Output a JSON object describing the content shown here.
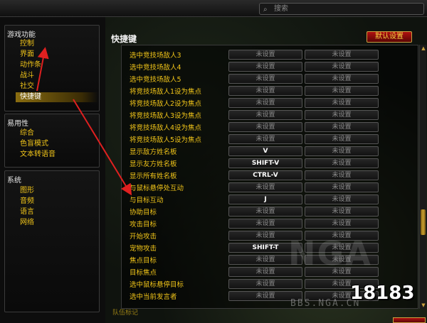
{
  "search": {
    "placeholder": "搜索"
  },
  "sidebar": {
    "sections": [
      {
        "title": "游戏功能",
        "items": [
          "控制",
          "界面",
          "动作条",
          "战斗",
          "社交",
          "快捷键"
        ],
        "selected": 5
      },
      {
        "title": "易用性",
        "items": [
          "综合",
          "色盲模式",
          "文本转语音"
        ]
      },
      {
        "title": "系统",
        "items": [
          "图形",
          "音频",
          "语言",
          "网络"
        ]
      }
    ]
  },
  "main": {
    "title": "快捷键",
    "default_button": "默认设置",
    "bindings": [
      {
        "label": "选中竞技场敌人3",
        "key1": "未设置",
        "key2": "未设置"
      },
      {
        "label": "选中竞技场敌人4",
        "key1": "未设置",
        "key2": "未设置"
      },
      {
        "label": "选中竞技场敌人5",
        "key1": "未设置",
        "key2": "未设置"
      },
      {
        "label": "将竞技场敌人1设为焦点",
        "key1": "未设置",
        "key2": "未设置"
      },
      {
        "label": "将竞技场敌人2设为焦点",
        "key1": "未设置",
        "key2": "未设置"
      },
      {
        "label": "将竞技场敌人3设为焦点",
        "key1": "未设置",
        "key2": "未设置"
      },
      {
        "label": "将竞技场敌人4设为焦点",
        "key1": "未设置",
        "key2": "未设置"
      },
      {
        "label": "将竞技场敌人5设为焦点",
        "key1": "未设置",
        "key2": "未设置"
      },
      {
        "label": "显示敌方姓名板",
        "key1": "V",
        "key2": "未设置"
      },
      {
        "label": "显示友方姓名板",
        "key1": "SHIFT-V",
        "key2": "未设置"
      },
      {
        "label": "显示所有姓名板",
        "key1": "CTRL-V",
        "key2": "未设置"
      },
      {
        "label": "与鼠标悬停处互动",
        "key1": "未设置",
        "key2": "未设置"
      },
      {
        "label": "与目标互动",
        "key1": "J",
        "key2": "未设置"
      },
      {
        "label": "协助目标",
        "key1": "未设置",
        "key2": "未设置"
      },
      {
        "label": "攻击目标",
        "key1": "未设置",
        "key2": "未设置"
      },
      {
        "label": "开始攻击",
        "key1": "未设置",
        "key2": "未设置"
      },
      {
        "label": "宠物攻击",
        "key1": "SHIFT-T",
        "key2": "未设置"
      },
      {
        "label": "焦点目标",
        "key1": "未设置",
        "key2": "未设置"
      },
      {
        "label": "目标焦点",
        "key1": "未设置",
        "key2": "未设置"
      },
      {
        "label": "选中鼠标悬停目标",
        "key1": "未设置",
        "key2": "未设置"
      },
      {
        "label": "选中当前发言者",
        "key1": "未设置",
        "key2": "未设置"
      }
    ],
    "next_section_partial": "队伍标记"
  },
  "watermark": {
    "logo": "18183",
    "site": "BBS.NGA.CN"
  },
  "colors": {
    "label": "#f0c419",
    "accent_red": "#b01010",
    "selected": "#8a6d10"
  }
}
